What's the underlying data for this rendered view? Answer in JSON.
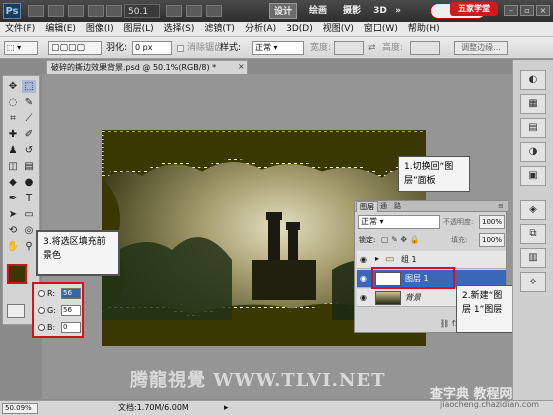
{
  "app": {
    "logo": "Ps",
    "zoom": "50.1",
    "workspaces": [
      "设计",
      "绘画",
      "摄影",
      "3D",
      "»"
    ],
    "brand_badge": "五家学堂"
  },
  "menubar": [
    "文件(F)",
    "编辑(E)",
    "图像(I)",
    "图层(L)",
    "选择(S)",
    "滤镜(T)",
    "分析(A)",
    "3D(D)",
    "视图(V)",
    "窗口(W)",
    "帮助(H)"
  ],
  "options": {
    "feather_label": "羽化:",
    "feather_value": "0 px",
    "antialias_label": "消除锯齿",
    "style_label": "样式:",
    "style_value": "正常",
    "width_label": "宽度:",
    "height_label": "高度:",
    "refine_edge": "调整边缘..."
  },
  "document": {
    "tab_title": "破碎的撕边效果背景.psd @ 50.1%(RGB/8) *",
    "close": "×"
  },
  "layers_panel": {
    "tabs": [
      "图层",
      "通",
      "路"
    ],
    "blend_mode": "正常",
    "opacity_label": "不透明度:",
    "opacity_value": "100%",
    "lock_label": "锁定:",
    "fill_label": "填充:",
    "fill_value": "100%",
    "layers": [
      {
        "name": "组 1",
        "type": "group"
      },
      {
        "name": "图层 1",
        "type": "layer",
        "selected": true
      },
      {
        "name": "背景",
        "type": "background"
      }
    ],
    "bottom_icons": "⛓ fx ◐ ▢ ▣ 🗑"
  },
  "callouts": {
    "step1": "1.切换回“图层”面板",
    "step2": "2.新建“图层 1”图层",
    "step3": "3.将选区填充前景色"
  },
  "color_picker": {
    "r_label": "R:",
    "r_value": "56",
    "g_label": "G:",
    "g_value": "56",
    "b_label": "B:",
    "b_value": "0",
    "foreground_color": "#383800"
  },
  "watermark": {
    "text": "腾龍視覺 WWW.TLVI.NET",
    "site": "查字典 教程网",
    "site_url": "jiaocheng.chazidian.com"
  },
  "statusbar": {
    "zoom": "50.09%",
    "doc": "文档:1.70M/6.00M"
  },
  "colors": {
    "accent_red": "#d4121b",
    "selection_blue": "#3b67b8"
  }
}
